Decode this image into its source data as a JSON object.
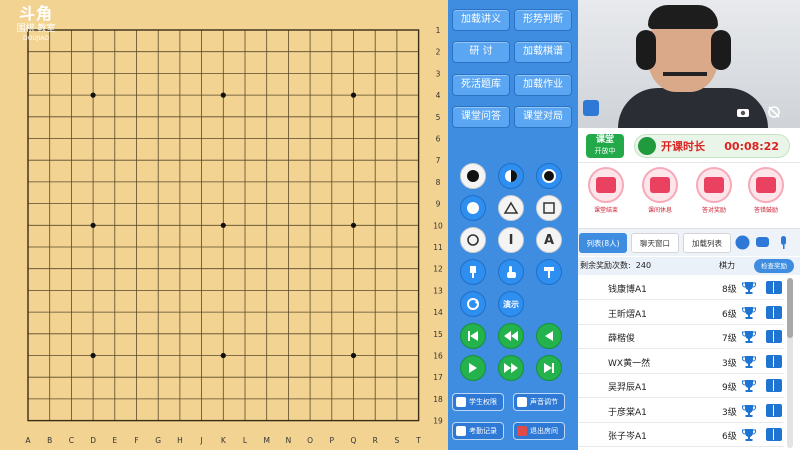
{
  "logo": {
    "main": "斗角",
    "sub": "围棋·教室",
    "tiny": "DOUJIAO"
  },
  "board": {
    "size": 19,
    "col_labels": [
      "A",
      "B",
      "C",
      "D",
      "E",
      "F",
      "G",
      "H",
      "J",
      "K",
      "L",
      "M",
      "N",
      "O",
      "P",
      "Q",
      "R",
      "S",
      "T"
    ],
    "row_labels": [
      "1",
      "2",
      "3",
      "4",
      "5",
      "6",
      "7",
      "8",
      "9",
      "10",
      "11",
      "12",
      "13",
      "14",
      "15",
      "16",
      "17",
      "18",
      "19"
    ],
    "star_points": [
      [
        4,
        4
      ],
      [
        10,
        4
      ],
      [
        16,
        4
      ],
      [
        4,
        10
      ],
      [
        10,
        10
      ],
      [
        16,
        10
      ],
      [
        4,
        16
      ],
      [
        10,
        16
      ],
      [
        16,
        16
      ]
    ]
  },
  "toolbar": {
    "lecture": "加载讲义",
    "situation": "形势判断",
    "research": "研  讨",
    "load_record": "加载棋谱",
    "life_death": "死活题库",
    "homework": "加载作业",
    "qa": "课堂问答",
    "match": "课堂对局",
    "text_icon": "I",
    "letter_icon": "A",
    "demo": "演示",
    "student_perm": "学生权限",
    "sound": "声音调节",
    "exam_record": "考勤记录",
    "leave_room": "退出房间"
  },
  "timer": {
    "badge_top": "课堂",
    "badge_bottom": "开放中",
    "label": "开课时长",
    "value": "00:08:22"
  },
  "actions": [
    {
      "label": "课堂结束"
    },
    {
      "label": "课间休息"
    },
    {
      "label": "答对奖励"
    },
    {
      "label": "答错鼓励"
    }
  ],
  "tabs": {
    "list": "列表(8人)",
    "chat": "聊天窗口",
    "load_list": "加载列表"
  },
  "reward": {
    "label": "剩余奖励次数:",
    "count": "240",
    "rank_header": "棋力",
    "button": "检查奖励"
  },
  "students": [
    {
      "name": "钱康博A1",
      "rank": "8级"
    },
    {
      "name": "王昕熠A1",
      "rank": "6级"
    },
    {
      "name": "薛楷俊",
      "rank": "7级"
    },
    {
      "name": "WX黄一然",
      "rank": "3级"
    },
    {
      "name": "吴羿辰A1",
      "rank": "9级"
    },
    {
      "name": "于彦棠A1",
      "rank": "3级"
    },
    {
      "name": "张子岑A1",
      "rank": "6级"
    }
  ],
  "colors": {
    "board": "#f2d392",
    "panel_blue": "#3f8de0",
    "accent_red": "#e9415f",
    "green": "#23b24b"
  }
}
